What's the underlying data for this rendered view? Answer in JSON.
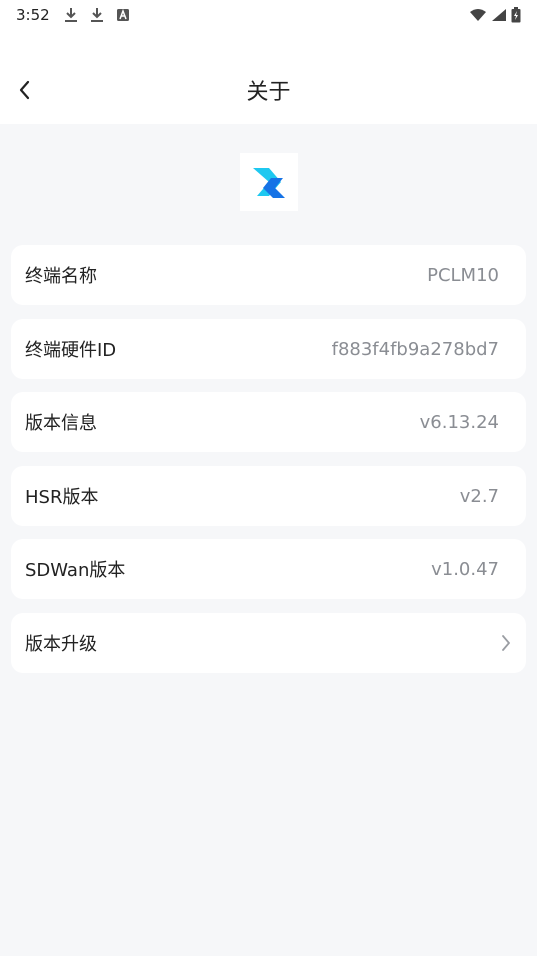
{
  "status_bar": {
    "time": "3:52",
    "icons_left": [
      "download-icon",
      "download-icon",
      "a-notification-icon"
    ],
    "icons_right": [
      "wifi-icon",
      "signal-icon",
      "battery-charging-icon"
    ]
  },
  "header": {
    "title": "关于",
    "back_icon": "chevron-left-icon"
  },
  "logo": {
    "icon": "app-logo-icon",
    "colors": [
      "#1ec8f0",
      "#1673e6"
    ]
  },
  "items": [
    {
      "label": "终端名称",
      "value": "PCLM10"
    },
    {
      "label": "终端硬件ID",
      "value": "f883f4fb9a278bd7"
    },
    {
      "label": "版本信息",
      "value": "v6.13.24"
    },
    {
      "label": "HSR版本",
      "value": "v2.7"
    },
    {
      "label": "SDWan版本",
      "value": "v1.0.47"
    },
    {
      "label": "版本升级",
      "value": "",
      "icon": "chevron-right-icon"
    }
  ],
  "colors": {
    "background": "#f6f7f9",
    "card": "#ffffff",
    "value_text": "#8a8d93"
  }
}
